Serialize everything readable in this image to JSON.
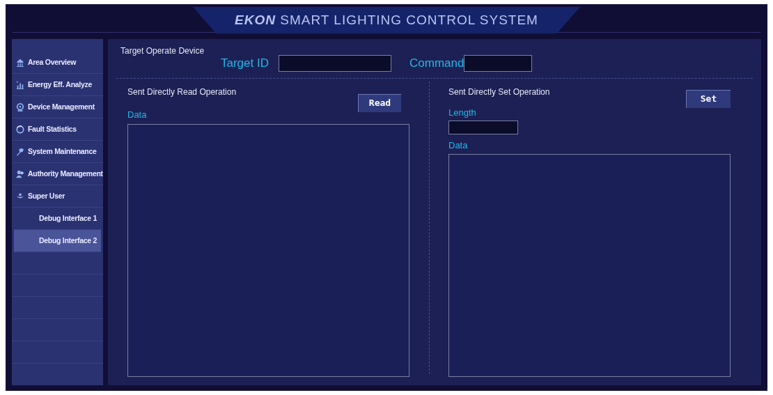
{
  "header": {
    "title": "**EKON** SMART LIGHTING CONTROL SYSTEM"
  },
  "sidebar": {
    "items": [
      {
        "label": "Area Overview",
        "selected": false
      },
      {
        "label": "Energy Eff. Analyze",
        "selected": false
      },
      {
        "label": "Device Management",
        "selected": false
      },
      {
        "label": "Fault Statistics",
        "selected": false
      },
      {
        "label": "System Maintenance",
        "selected": false
      },
      {
        "label": "Authority Management",
        "selected": false
      },
      {
        "label": "Super User",
        "selected": false,
        "children": [
          {
            "label": "Debug Interface 1",
            "selected": false
          },
          {
            "label": "Debug Interface 2",
            "selected": true
          }
        ]
      }
    ]
  },
  "target": {
    "title": "Target Operate Device",
    "target_id_label": "Target ID",
    "command_label": "Command"
  },
  "read": {
    "title": "Sent Directly Read Operation",
    "button": "Read",
    "data_label": "Data"
  },
  "set": {
    "title": "Sent Directly Set Operation",
    "button": "Set",
    "length_label": "Length",
    "data_label": "Data"
  }
}
